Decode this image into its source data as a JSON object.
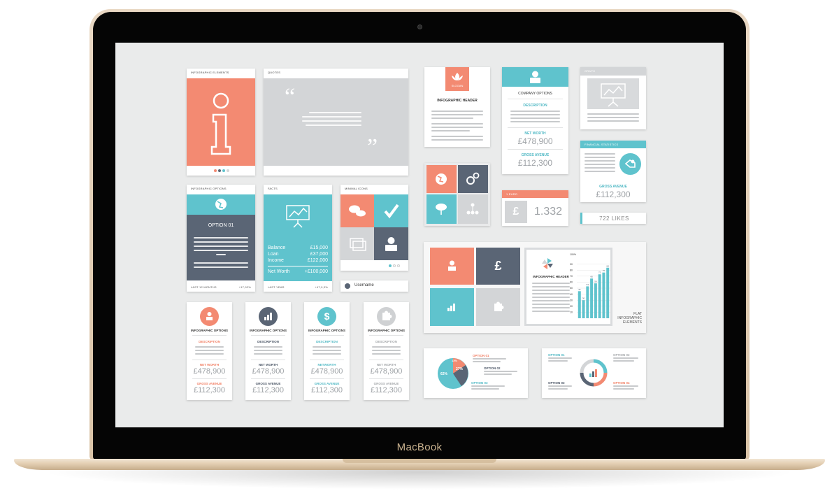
{
  "device": {
    "brand": "MacBook"
  },
  "cards": {
    "infographic_elements": {
      "caption": "INFOGRAPHIC ELEMENTS",
      "glyph": "i"
    },
    "quotes": {
      "caption": "QUOTES",
      "open_quote": "“",
      "close_quote": "”"
    },
    "infographic_header": {
      "badge": "SLOGAN",
      "title": "INFOGRAPHIC HEADER"
    },
    "company_options": {
      "title": "COMPANY OPTIONS",
      "description_label": "DESCRIPTION",
      "net_worth_label": "NET WORTH",
      "net_worth_value": "£478,900",
      "gross_label": "GROSS AVENUE",
      "gross_value": "£112,300"
    },
    "graph": {
      "caption": "GRAPH"
    },
    "financial_statistics": {
      "caption": "FINANCIAL STATISTICS",
      "gross_label": "GROSS AVENUE",
      "gross_value": "£112,300"
    },
    "euro": {
      "caption": "1 EURO",
      "symbol": "£",
      "rate": "1.332"
    },
    "likes": {
      "label": "722 LIKES"
    },
    "infographic_options_teal": {
      "caption": "INFOGRAPHIC OPTIONS",
      "option": "OPTION 01",
      "footer_left": "LAST 12 MONTHS",
      "footer_right": "+17,92%"
    },
    "facts": {
      "caption": "FACTS",
      "rows": [
        {
          "label": "Balance",
          "value": "£15,000"
        },
        {
          "label": "Loan",
          "value": "£37,000"
        },
        {
          "label": "Income",
          "value": "£122,000"
        }
      ],
      "net_label": "Net Worth",
      "net_value": "+£100,000",
      "footer_left": "LAST YEAR",
      "footer_right": "+47,9,3%"
    },
    "minimal_icons": {
      "caption": "MINIMAL ICONS",
      "username": "Username"
    },
    "options_row": [
      {
        "title": "INFOGRAPHIC OPTIONS",
        "description_label": "DESCRIPTION",
        "net_label": "NET WORTH",
        "net_value": "£478,900",
        "gross_label": "GROSS AVENUE",
        "gross_value": "£112,300",
        "accent": "#f38a72"
      },
      {
        "title": "INFOGRAPHIC OPTIONS",
        "description_label": "DESCRIPTION",
        "net_label": "NET WORTH",
        "net_value": "£478,900",
        "gross_label": "GROSS AVENUE",
        "gross_value": "£112,300",
        "accent": "#5a6575"
      },
      {
        "title": "INFOGRAPHIC OPTIONS",
        "description_label": "DESCRIPTION",
        "net_label": "NETWORTH",
        "net_value": "£478,900",
        "gross_label": "GROSS AVENUE",
        "gross_value": "£112,300",
        "accent": "#5fc3cd"
      },
      {
        "title": "INFOGRAPHIC OPTIONS",
        "description_label": "DESCRIPTION",
        "net_label": "NET WORTH",
        "net_value": "£478,900",
        "gross_label": "GROSS AVENUE",
        "gross_value": "£112,300",
        "accent": "#cfd1d3"
      }
    ],
    "flat_panel": {
      "header": "INFOGRAPHIC HEADER",
      "caption_line1": "FLAT",
      "caption_line2": "INFOGRAPHIC",
      "caption_line3": "ELEMENTS",
      "chart_top": "100%",
      "y_ticks": [
        "90",
        "80",
        "70",
        "60",
        "50",
        "40",
        "30",
        "20",
        "10"
      ],
      "bars": [
        45,
        30,
        53,
        66,
        58,
        73,
        76,
        84
      ],
      "bar_labels": [
        "45",
        "30",
        "53",
        "66",
        "58",
        "73",
        "76",
        "84"
      ]
    },
    "pie_panel": {
      "labels": [
        "OPTION 01",
        "OPTION 02",
        "OPTION 03"
      ],
      "big_pct": "62%",
      "mid_pct": "27%",
      "small_pct": "13%"
    },
    "ring_panel": {
      "labels": [
        "OPTION 01",
        "OPTION 02",
        "OPTION 03",
        "OPTION 04"
      ]
    }
  },
  "colors": {
    "coral": "#f38a72",
    "teal": "#5fc3cd",
    "slate": "#5a6575",
    "grey": "#d3d5d7",
    "screen": "#eaebeb"
  }
}
